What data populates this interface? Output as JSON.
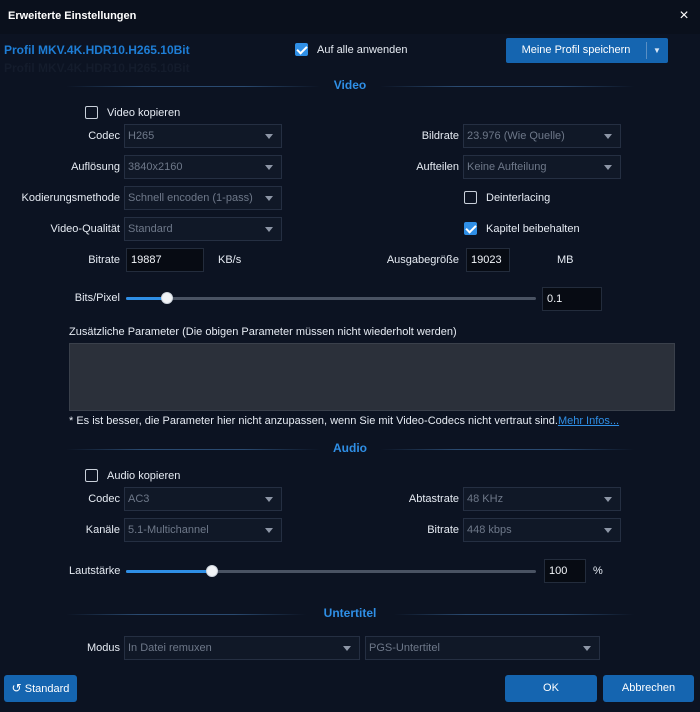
{
  "window": {
    "title": "Erweiterte Einstellungen",
    "close_glyph": "×"
  },
  "profile": {
    "name": "Profil MKV.4K.HDR10.H265.10Bit"
  },
  "apply_all": {
    "label": "Auf alle anwenden",
    "checked": true
  },
  "save_profile": {
    "label": "Meine Profil speichern"
  },
  "video": {
    "section_title": "Video",
    "copy": {
      "label": "Video kopieren",
      "checked": false
    },
    "codec": {
      "label": "Codec",
      "value": "H265"
    },
    "resolution": {
      "label": "Auflösung",
      "value": "3840x2160"
    },
    "encoding": {
      "label": "Kodierungsmethode",
      "value": "Schnell encoden (1-pass)"
    },
    "quality": {
      "label": "Video-Qualität",
      "value": "Standard"
    },
    "bitrate": {
      "label": "Bitrate",
      "value": "19887",
      "unit": "KB/s"
    },
    "framerate": {
      "label": "Bildrate",
      "value": "23.976 (Wie Quelle)"
    },
    "split": {
      "label": "Aufteilen",
      "value": "Keine Aufteilung"
    },
    "deinterlacing": {
      "label": "Deinterlacing",
      "checked": false
    },
    "chapters": {
      "label": "Kapitel beibehalten",
      "checked": true
    },
    "output_size": {
      "label": "Ausgabegröße",
      "value": "19023",
      "unit": "MB"
    },
    "bits_pixel": {
      "label": "Bits/Pixel",
      "value": "0.1",
      "fraction": 0.1
    },
    "extra_params": {
      "label": "Zusätzliche Parameter (Die obigen Parameter müssen nicht wiederholt werden)",
      "value": ""
    },
    "note": "* Es ist besser, die Parameter hier nicht anzupassen, wenn Sie mit Video-Codecs nicht vertraut sind.",
    "more_info": "Mehr Infos..."
  },
  "audio": {
    "section_title": "Audio",
    "copy": {
      "label": "Audio kopieren",
      "checked": false
    },
    "codec": {
      "label": "Codec",
      "value": "AC3"
    },
    "channels": {
      "label": "Kanäle",
      "value": "5.1-Multichannel"
    },
    "samplerate": {
      "label": "Abtastrate",
      "value": "48 KHz"
    },
    "bitrate": {
      "label": "Bitrate",
      "value": "448 kbps"
    },
    "volume": {
      "label": "Lautstärke",
      "value": "100",
      "unit": "%",
      "fraction": 0.21
    }
  },
  "subtitle": {
    "section_title": "Untertitel",
    "mode": {
      "label": "Modus",
      "value": "In Datei remuxen"
    },
    "type": {
      "value": "PGS-Untertitel"
    }
  },
  "footer": {
    "standard_label": "Standard",
    "ok_label": "OK",
    "cancel_label": "Abbrechen"
  },
  "colors": {
    "background": "#0c1322",
    "accent": "#2f8fe6",
    "button": "#1565b0",
    "profile_text": "#1e7ed6"
  }
}
